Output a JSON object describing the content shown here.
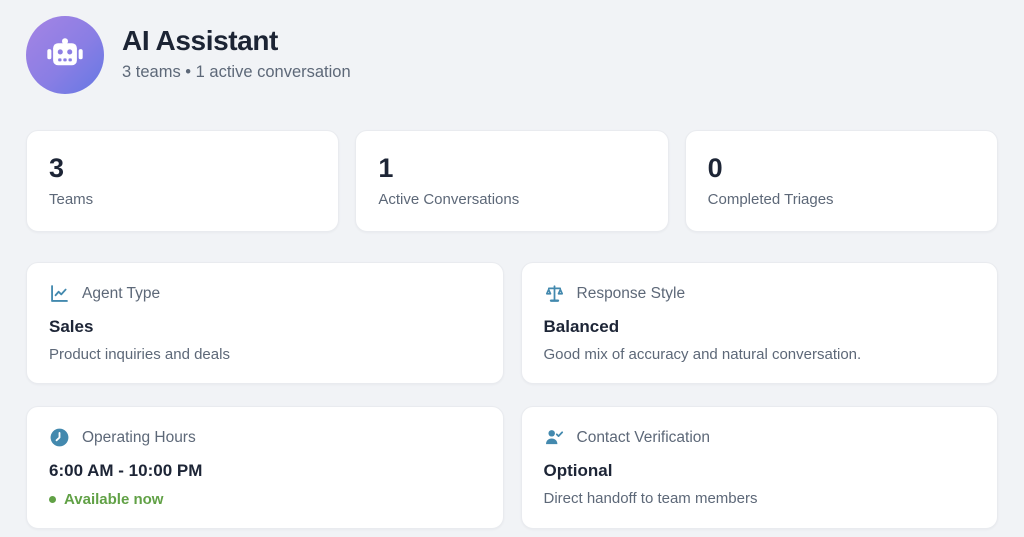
{
  "header": {
    "title": "AI Assistant",
    "subtitle": "3 teams • 1 active conversation",
    "avatar_icon": "robot-icon"
  },
  "stats": [
    {
      "value": "3",
      "label": "Teams"
    },
    {
      "value": "1",
      "label": "Active Conversations"
    },
    {
      "value": "0",
      "label": "Completed Triages"
    }
  ],
  "cards": {
    "agent_type": {
      "icon": "chart-line-icon",
      "title": "Agent Type",
      "value": "Sales",
      "description": "Product inquiries and deals"
    },
    "response_style": {
      "icon": "balance-scale-icon",
      "title": "Response Style",
      "value": "Balanced",
      "description": "Good mix of accuracy and natural conversation."
    },
    "operating_hours": {
      "icon": "clock-icon",
      "title": "Operating Hours",
      "value": "6:00 AM - 10:00 PM",
      "status": "Available now"
    },
    "contact_verification": {
      "icon": "person-check-icon",
      "title": "Contact Verification",
      "value": "Optional",
      "description": "Direct handoff to team members"
    }
  },
  "colors": {
    "avatar_gradient_start": "#a584e4",
    "avatar_gradient_end": "#6478e3",
    "icon_blue": "#4389ae",
    "status_green": "#61a146",
    "heading_dark": "#1d2536",
    "muted_gray": "#5d6878",
    "page_background": "#f1f3f6",
    "card_background": "#ffffff"
  }
}
